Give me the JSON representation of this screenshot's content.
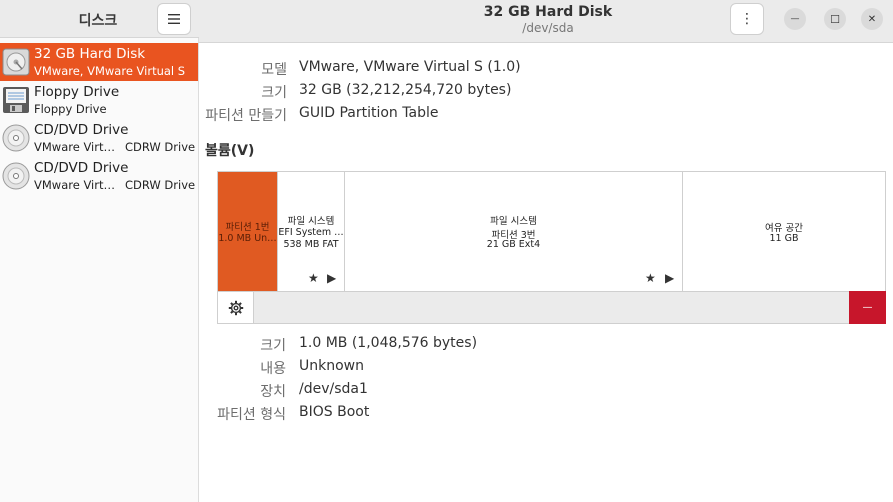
{
  "sidebar": {
    "title": "디스크",
    "menu_icon": "hamburger-menu-icon",
    "drives": [
      {
        "name": "32 GB Hard Disk",
        "sub": "VMware, VMware Virtual S",
        "sub2": "",
        "icon": "hard-disk-icon"
      },
      {
        "name": "Floppy Drive",
        "sub": "Floppy Drive",
        "sub2": "",
        "icon": "floppy-icon"
      },
      {
        "name": "CD/DVD Drive",
        "sub": "VMware Virt…",
        "sub2": "CDRW Drive",
        "icon": "optical-disc-icon"
      },
      {
        "name": "CD/DVD Drive",
        "sub": "VMware Virt…",
        "sub2": "CDRW Drive",
        "icon": "optical-disc-icon"
      }
    ]
  },
  "header": {
    "title": "32 GB Hard Disk",
    "subtitle": "/dev/sda",
    "kebab": "⋮",
    "minimize": "—",
    "maximize": "☐",
    "close": "✕"
  },
  "disk_info": {
    "model_label": "모델",
    "model_value": "VMware, VMware Virtual S (1.0)",
    "size_label": "크기",
    "size_value": "32 GB (32,212,254,720 bytes)",
    "partitioning_label": "파티션 만들기",
    "partitioning_value": "GUID Partition Table"
  },
  "volumes": {
    "heading": "볼륨(V)",
    "segments": [
      {
        "line1": "파티션 1번",
        "line2": "1.0 MB Un…",
        "line3": ""
      },
      {
        "line1": "파일 시스템",
        "line2": "EFI System …",
        "line3": "538 MB FAT"
      },
      {
        "line1": "파일 시스템",
        "line2": "파티션 3번",
        "line3": "21 GB Ext4"
      },
      {
        "line1": "여유 공간",
        "line2": "11 GB",
        "line3": ""
      }
    ],
    "star_glyph": "★",
    "play_glyph": "▶",
    "delete_glyph": "—"
  },
  "partition_info": {
    "size_label": "크기",
    "size_value": "1.0 MB (1,048,576 bytes)",
    "content_label": "내용",
    "content_value": "Unknown",
    "device_label": "장치",
    "device_value": "/dev/sda1",
    "type_label": "파티션 형식",
    "type_value": "BIOS Boot"
  },
  "colors": {
    "accent": "#e95420",
    "selected_partition": "#e05a22",
    "danger": "#c7162b"
  }
}
